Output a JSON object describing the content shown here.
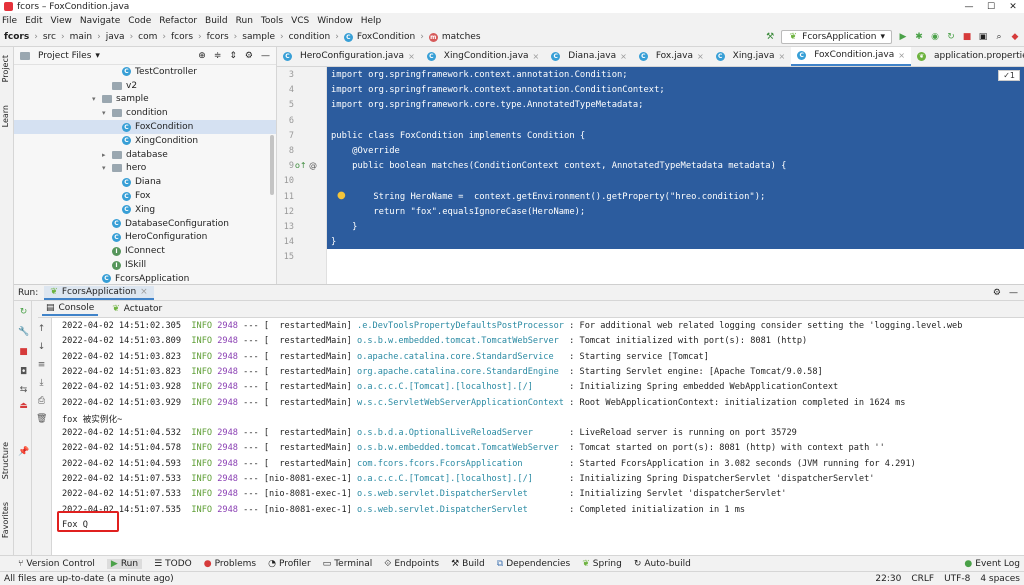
{
  "window": {
    "title": "fcors – FoxCondition.java",
    "min": "—",
    "max": "☐",
    "close": "✕"
  },
  "menu": [
    "File",
    "Edit",
    "View",
    "Navigate",
    "Code",
    "Refactor",
    "Build",
    "Run",
    "Tools",
    "VCS",
    "Window",
    "Help"
  ],
  "breadcrumb": [
    "fcors",
    "src",
    "main",
    "java",
    "com",
    "fcors",
    "fcors",
    "sample",
    "condition",
    "FoxCondition",
    "matches"
  ],
  "run_config": "FcorsApplication",
  "left_stripe": {
    "project": "Project",
    "learn": "Learn",
    "structure": "Structure",
    "favorites": "Favorites"
  },
  "project_panel": {
    "title": "Project Files",
    "items": [
      {
        "indent": 10,
        "type": "class",
        "label": "TestController",
        "arrow": ""
      },
      {
        "indent": 9,
        "type": "folder",
        "label": "v2",
        "arrow": ""
      },
      {
        "indent": 8,
        "type": "folder",
        "label": "sample",
        "arrow": "v"
      },
      {
        "indent": 9,
        "type": "folder",
        "label": "condition",
        "arrow": "v"
      },
      {
        "indent": 10,
        "type": "class",
        "label": "FoxCondition",
        "arrow": "",
        "selected": true
      },
      {
        "indent": 10,
        "type": "class",
        "label": "XingCondition",
        "arrow": ""
      },
      {
        "indent": 9,
        "type": "folder",
        "label": "database",
        "arrow": ">"
      },
      {
        "indent": 9,
        "type": "folder",
        "label": "hero",
        "arrow": "v"
      },
      {
        "indent": 10,
        "type": "class",
        "label": "Diana",
        "arrow": ""
      },
      {
        "indent": 10,
        "type": "class",
        "label": "Fox",
        "arrow": ""
      },
      {
        "indent": 10,
        "type": "class",
        "label": "Xing",
        "arrow": ""
      },
      {
        "indent": 9,
        "type": "class",
        "label": "DatabaseConfiguration",
        "arrow": ""
      },
      {
        "indent": 9,
        "type": "class",
        "label": "HeroConfiguration",
        "arrow": ""
      },
      {
        "indent": 9,
        "type": "interface",
        "label": "IConnect",
        "arrow": ""
      },
      {
        "indent": 9,
        "type": "interface",
        "label": "ISkill",
        "arrow": ""
      },
      {
        "indent": 8,
        "type": "class",
        "label": "FcorsApplication",
        "arrow": ""
      }
    ]
  },
  "tabs": [
    {
      "label": "HeroConfiguration.java"
    },
    {
      "label": "XingCondition.java"
    },
    {
      "label": "Diana.java"
    },
    {
      "label": "Fox.java"
    },
    {
      "label": "Xing.java"
    },
    {
      "label": "FoxCondition.java",
      "active": true
    },
    {
      "label": "application.properties"
    }
  ],
  "editor": {
    "inspection": "✓1",
    "line_numbers": [
      "3",
      "4",
      "5",
      "6",
      "7",
      "8",
      "9",
      "10",
      "11",
      "12",
      "13",
      "14",
      "15"
    ],
    "lines": [
      "import org.springframework.context.annotation.Condition;",
      "import org.springframework.context.annotation.ConditionContext;",
      "import org.springframework.core.type.AnnotatedTypeMetadata;",
      "",
      "public class FoxCondition implements Condition {",
      "    @Override",
      "    public boolean matches(ConditionContext context, AnnotatedTypeMetadata metadata) {",
      "",
      "        String HeroName =  context.getEnvironment().getProperty(\"hreo.condition\");",
      "        return \"fox\".equalsIgnoreCase(HeroName);",
      "    }",
      "}",
      ""
    ]
  },
  "run_panel": {
    "label": "Run:",
    "config_tab": "FcorsApplication",
    "subtabs": [
      "Console",
      "Actuator"
    ]
  },
  "console": {
    "lines": [
      {
        "ts": "2022-04-02 14:51:02.305",
        "level": "INFO",
        "pid": "2948",
        "sep": "---",
        "thread": "[  restartedMain]",
        "logger": ".e.DevToolsPropertyDefaultsPostProcessor",
        "msg": ": For additional web related logging consider setting the 'logging.level.web"
      },
      {
        "ts": "2022-04-02 14:51:03.809",
        "level": "INFO",
        "pid": "2948",
        "sep": "---",
        "thread": "[  restartedMain]",
        "logger": "o.s.b.w.embedded.tomcat.TomcatWebServer ",
        "msg": ": Tomcat initialized with port(s): 8081 (http)"
      },
      {
        "ts": "2022-04-02 14:51:03.823",
        "level": "INFO",
        "pid": "2948",
        "sep": "---",
        "thread": "[  restartedMain]",
        "logger": "o.apache.catalina.core.StandardService  ",
        "msg": ": Starting service [Tomcat]"
      },
      {
        "ts": "2022-04-02 14:51:03.823",
        "level": "INFO",
        "pid": "2948",
        "sep": "---",
        "thread": "[  restartedMain]",
        "logger": "org.apache.catalina.core.StandardEngine ",
        "msg": ": Starting Servlet engine: [Apache Tomcat/9.0.58]"
      },
      {
        "ts": "2022-04-02 14:51:03.928",
        "level": "INFO",
        "pid": "2948",
        "sep": "---",
        "thread": "[  restartedMain]",
        "logger": "o.a.c.c.C.[Tomcat].[localhost].[/]      ",
        "msg": ": Initializing Spring embedded WebApplicationContext"
      },
      {
        "ts": "2022-04-02 14:51:03.929",
        "level": "INFO",
        "pid": "2948",
        "sep": "---",
        "thread": "[  restartedMain]",
        "logger": "w.s.c.ServletWebServerApplicationContext",
        "msg": ": Root WebApplicationContext: initialization completed in 1624 ms"
      },
      {
        "plain": "fox 被实例化~"
      },
      {
        "ts": "2022-04-02 14:51:04.532",
        "level": "INFO",
        "pid": "2948",
        "sep": "---",
        "thread": "[  restartedMain]",
        "logger": "o.s.b.d.a.OptionalLiveReloadServer      ",
        "msg": ": LiveReload server is running on port 35729"
      },
      {
        "ts": "2022-04-02 14:51:04.578",
        "level": "INFO",
        "pid": "2948",
        "sep": "---",
        "thread": "[  restartedMain]",
        "logger": "o.s.b.w.embedded.tomcat.TomcatWebServer ",
        "msg": ": Tomcat started on port(s): 8081 (http) with context path ''"
      },
      {
        "ts": "2022-04-02 14:51:04.593",
        "level": "INFO",
        "pid": "2948",
        "sep": "---",
        "thread": "[  restartedMain]",
        "logger": "com.fcors.fcors.FcorsApplication        ",
        "msg": ": Started FcorsApplication in 3.082 seconds (JVM running for 4.291)"
      },
      {
        "ts": "2022-04-02 14:51:07.533",
        "level": "INFO",
        "pid": "2948",
        "sep": "---",
        "thread": "[nio-8081-exec-1]",
        "logger": "o.a.c.c.C.[Tomcat].[localhost].[/]      ",
        "msg": ": Initializing Spring DispatcherServlet 'dispatcherServlet'"
      },
      {
        "ts": "2022-04-02 14:51:07.533",
        "level": "INFO",
        "pid": "2948",
        "sep": "---",
        "thread": "[nio-8081-exec-1]",
        "logger": "o.s.web.servlet.DispatcherServlet       ",
        "msg": ": Initializing Servlet 'dispatcherServlet'"
      },
      {
        "ts": "2022-04-02 14:51:07.535",
        "level": "INFO",
        "pid": "2948",
        "sep": "---",
        "thread": "[nio-8081-exec-1]",
        "logger": "o.s.web.servlet.DispatcherServlet       ",
        "msg": ": Completed initialization in 1 ms"
      },
      {
        "plain": "Fox Q"
      }
    ]
  },
  "bottom_tools": [
    {
      "label": "Version Control",
      "icon": "branch-icon"
    },
    {
      "label": "Run",
      "icon": "play-icon",
      "active": true
    },
    {
      "label": "TODO",
      "icon": "list-icon"
    },
    {
      "label": "Problems",
      "icon": "error-icon"
    },
    {
      "label": "Profiler",
      "icon": "profiler-icon"
    },
    {
      "label": "Terminal",
      "icon": "terminal-icon"
    },
    {
      "label": "Endpoints",
      "icon": "endpoints-icon"
    },
    {
      "label": "Build",
      "icon": "hammer-icon"
    },
    {
      "label": "Dependencies",
      "icon": "dependencies-icon"
    },
    {
      "label": "Spring",
      "icon": "spring-icon"
    },
    {
      "label": "Auto-build",
      "icon": "autobuild-icon"
    }
  ],
  "event_log": "Event Log",
  "status": {
    "message": "All files are up-to-date (a minute ago)",
    "position": "22:30",
    "line_sep": "CRLF",
    "encoding": "UTF-8",
    "indent": "4 spaces"
  }
}
